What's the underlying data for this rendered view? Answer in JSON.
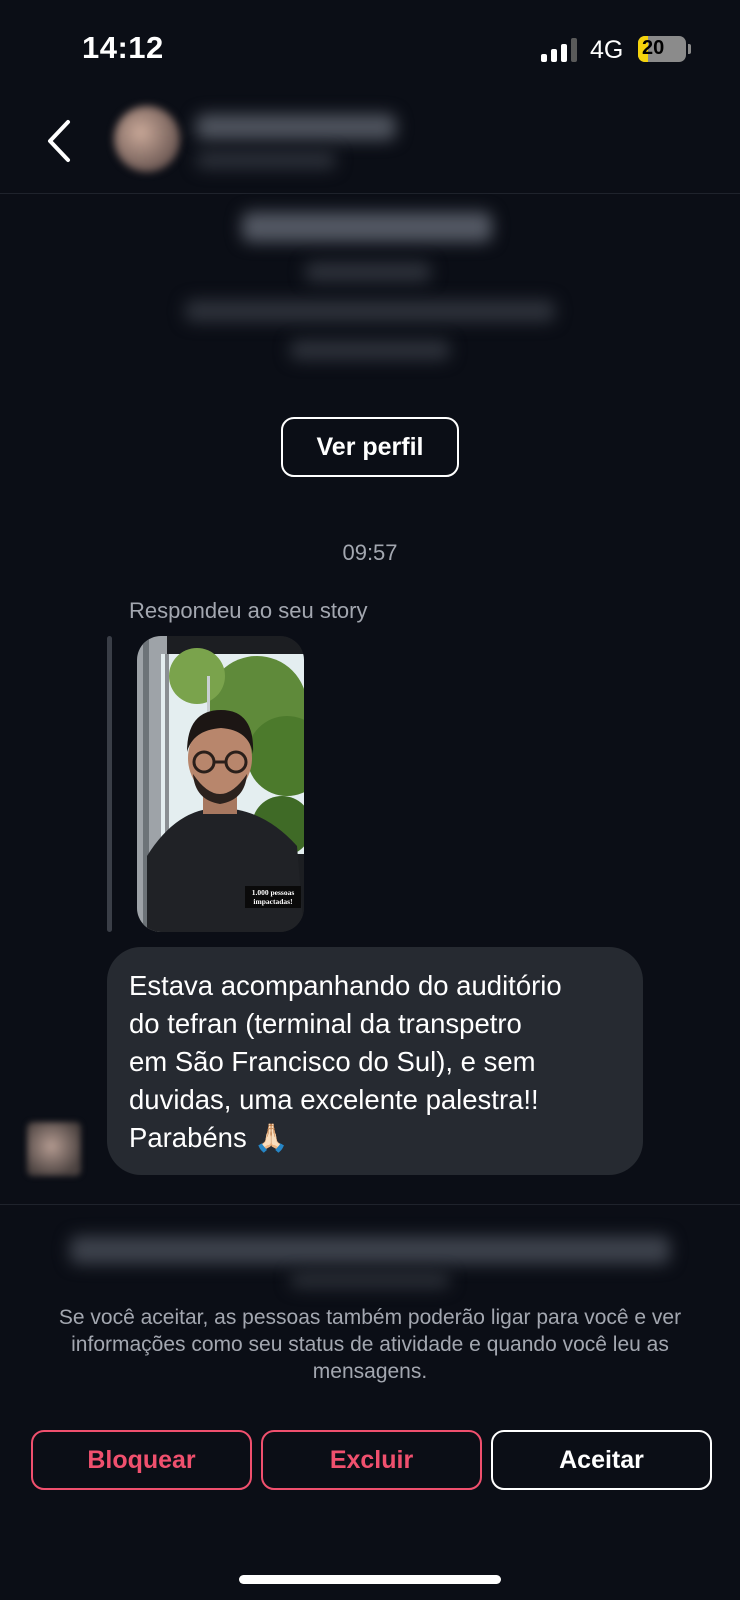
{
  "status_bar": {
    "time": "14:12",
    "network": "4G",
    "battery": "20",
    "battery_fraction": 0.2,
    "colors": {
      "battery_fill": "#f5d30c"
    }
  },
  "header": {
    "back_icon": "chevron-left-icon"
  },
  "intro": {
    "view_profile_label": "Ver perfil"
  },
  "conversation": {
    "timestamp": "09:57",
    "reply_label": "Respondeu ao seu story",
    "story": {
      "caption_line1": "1.000 pessoas",
      "caption_line2": "impactadas!"
    },
    "message": "Estava acompanhando do auditório\ndo tefran (terminal da transpetro\nem São Francisco do Sul), e sem\nduvidas, uma excelente palestra!!\nParabéns 🙏🏻"
  },
  "request": {
    "notice": "Se você aceitar, as pessoas também poderão ligar para você e ver informações como seu status de atividade e quando você leu as mensagens.",
    "buttons": {
      "block": "Bloquear",
      "delete": "Excluir",
      "accept": "Aceitar"
    },
    "colors": {
      "destructive": "#f0506e",
      "accept": "#ffffff"
    }
  },
  "colors": {
    "background": "#0b0e16",
    "bubble": "#262a31",
    "secondary_text": "#a3a7b0"
  }
}
